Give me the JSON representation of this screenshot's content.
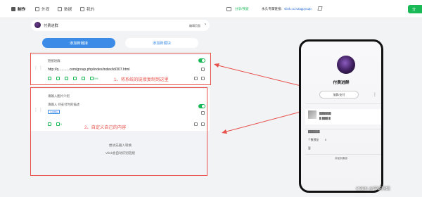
{
  "topbar": {
    "nav": [
      "制作",
      "外观",
      "数据",
      "我的"
    ],
    "top_link": "分享/预览",
    "share_label": "永久专属链接:",
    "share_url": "vlink.cc/4Jagpyu3p",
    "button": "分"
  },
  "group": {
    "name": "付费进群",
    "edit_label": "编辑页面",
    "chevron": "›"
  },
  "tabs": {
    "add_link": "添加新链接",
    "add_module": "添加新模块"
  },
  "card1": {
    "label": "链接进群",
    "url": "http://q...........com/group.php/index/index/id/307.html",
    "pct": "0%"
  },
  "card2": {
    "label1": "请输入图片介绍",
    "label2": "请输入 待支付时的描述",
    "tag": "上传图片",
    "count": "0",
    "hint1": "尝试先输入转换",
    "hint2": "Vlink会自动识别链接"
  },
  "annotations": {
    "note1": "1、将系统的链接复制到这里",
    "note2": "2、自定义自己的内容",
    "accent": "#e8504a"
  },
  "phone": {
    "title": "付费进群",
    "button": "加群/支付",
    "menu": "⋮",
    "rows": [
      "▓▓▓▓▓▓",
      "▓ ▓▓▓ ▓",
      "▓▓▓▓▓▓"
    ],
    "count_label": "个数预览",
    "count_value": "0",
    "status_label": "暂",
    "bottom": "添加到桌面"
  },
  "watermark": "CSDN @学识网络",
  "colors": {
    "green": "#19b955",
    "blue": "#3c8ce7"
  }
}
